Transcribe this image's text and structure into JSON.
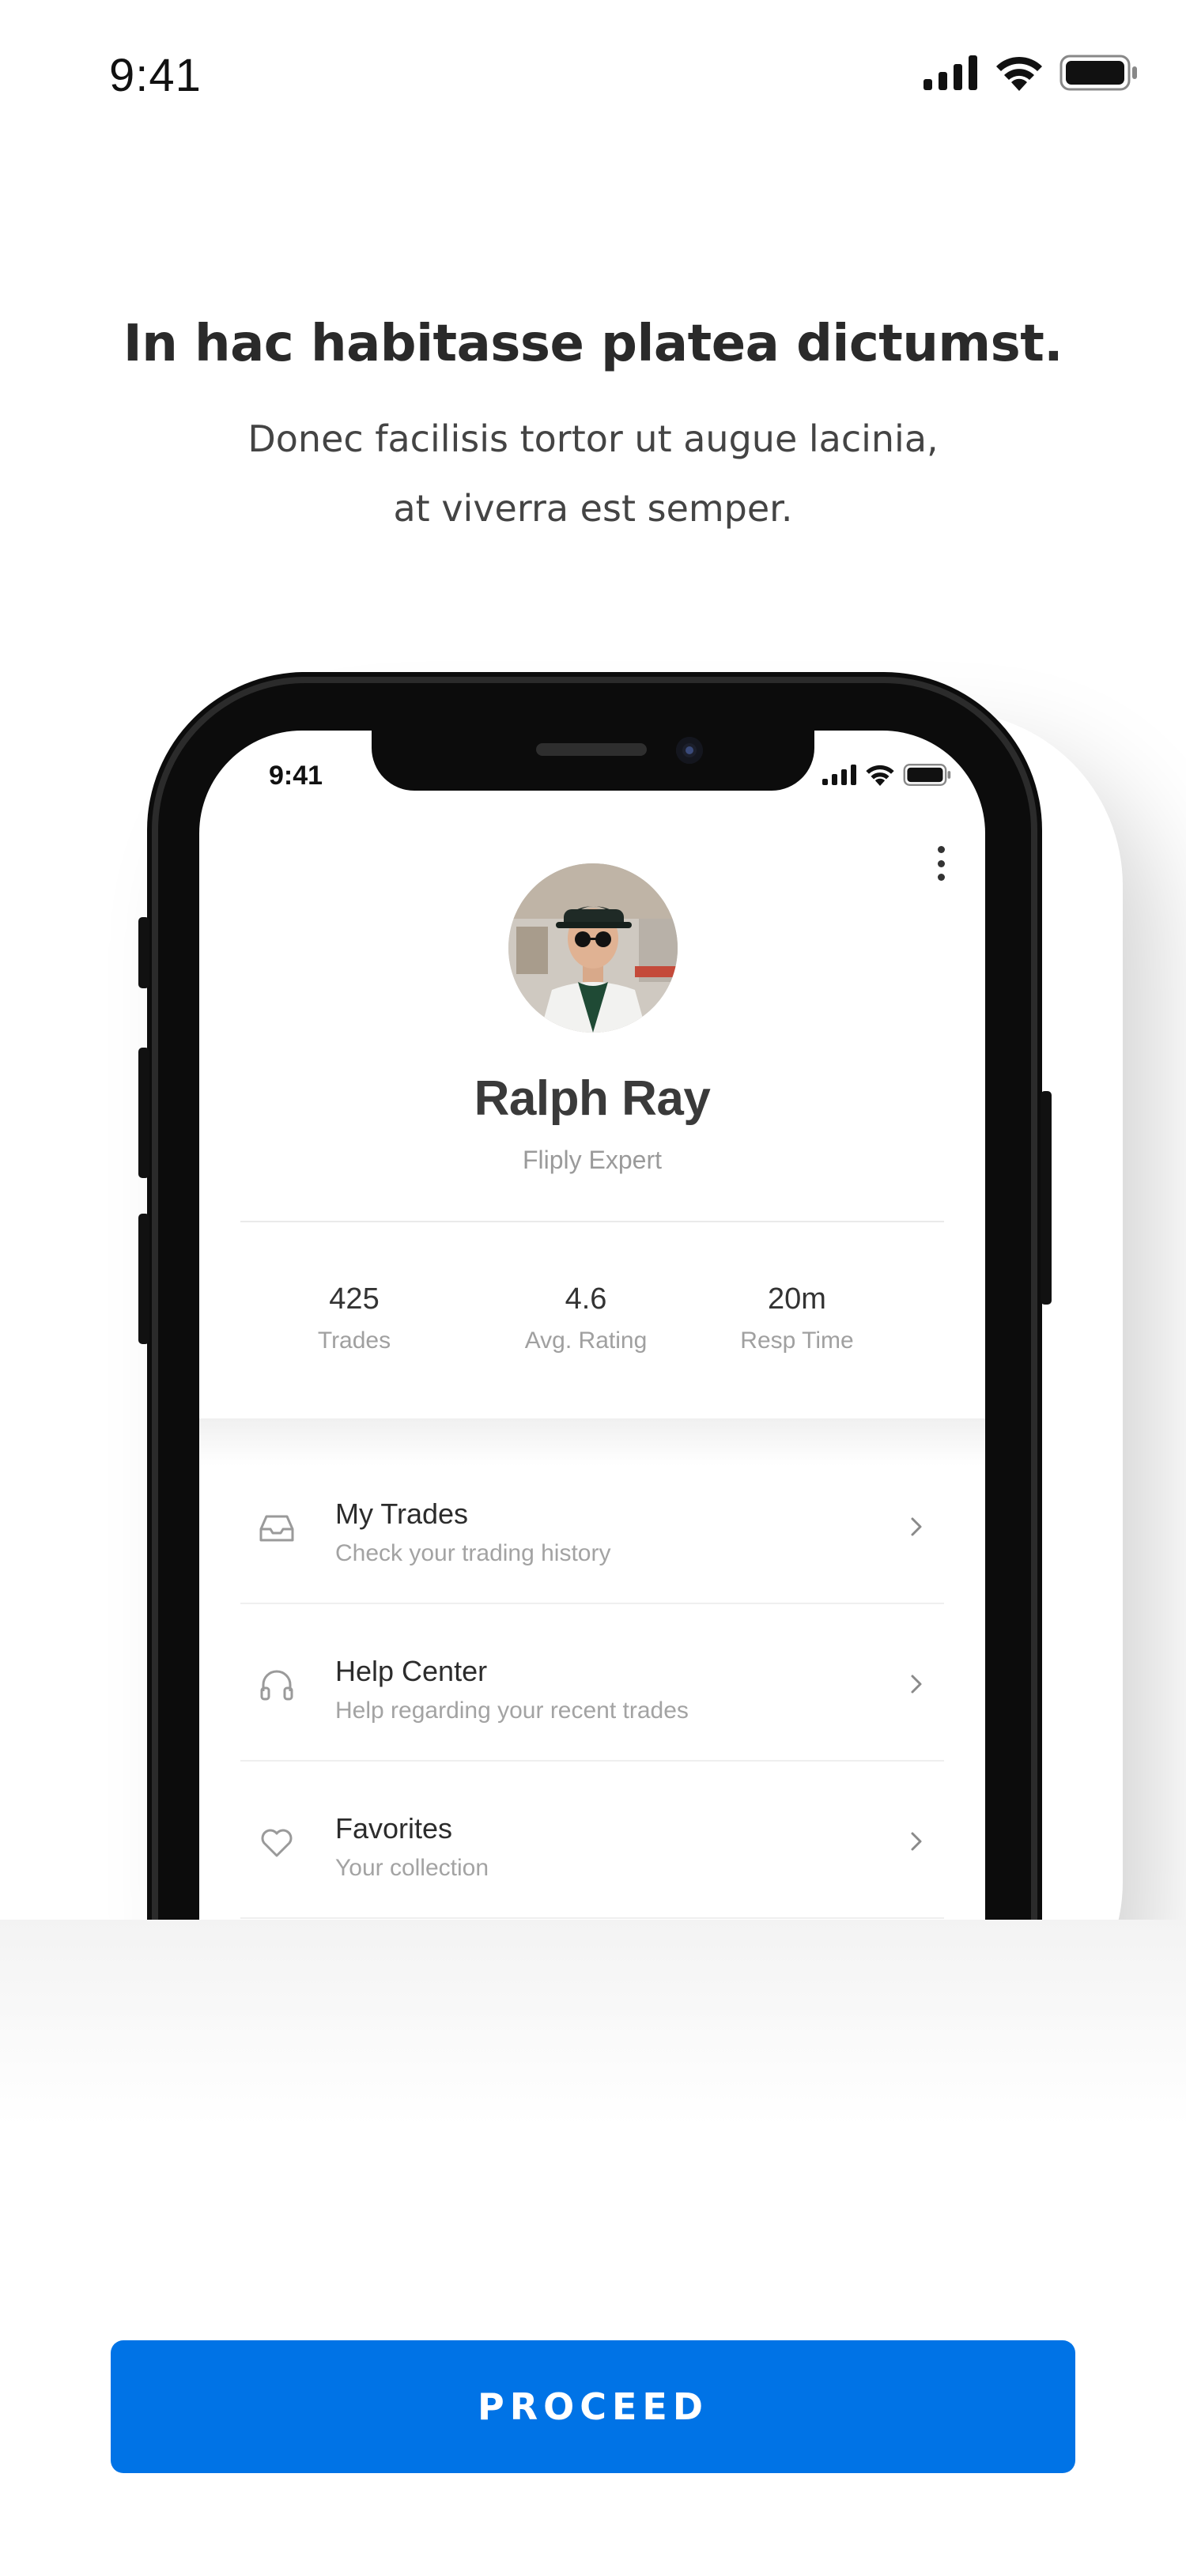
{
  "status_bar": {
    "time": "9:41",
    "icons": [
      "signal-icon",
      "wifi-icon",
      "battery-icon"
    ]
  },
  "intro": {
    "title": "In hac habitasse platea dictumst.",
    "subtitle_line1": "Donec facilisis tortor ut augue lacinia,",
    "subtitle_line2": "at viverra est semper."
  },
  "phone": {
    "status_time": "9:41",
    "profile": {
      "name": "Ralph Ray",
      "role": "Fliply Expert"
    },
    "stats": [
      {
        "value": "425",
        "label": "Trades"
      },
      {
        "value": "4.6",
        "label": "Avg. Rating"
      },
      {
        "value": "20m",
        "label": "Resp Time"
      }
    ],
    "menu": [
      {
        "title": "My Trades",
        "subtitle": "Check your trading history",
        "icon": "inbox-tray-icon"
      },
      {
        "title": "Help Center",
        "subtitle": "Help regarding your recent trades",
        "icon": "headphones-icon"
      },
      {
        "title": "Favorites",
        "subtitle": "Your collection",
        "icon": "heart-icon"
      }
    ]
  },
  "cta": {
    "label": "PROCEED"
  },
  "colors": {
    "accent": "#0073e6",
    "text_dark": "#2a2a2a",
    "text_muted": "#a0a0a0"
  }
}
